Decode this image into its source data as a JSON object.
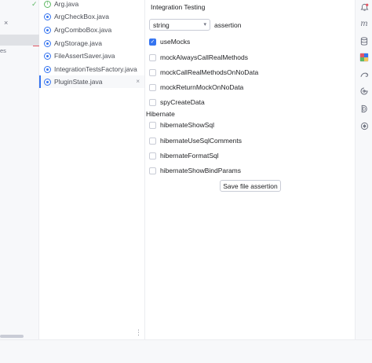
{
  "left_panel": {
    "close_glyph": "×",
    "truncated_text": "es"
  },
  "file_list": {
    "items": [
      {
        "name": "Arg.java",
        "icon": "interface-icon",
        "active": false
      },
      {
        "name": "ArgCheckBox.java",
        "icon": "class-icon",
        "active": false
      },
      {
        "name": "ArgComboBox.java",
        "icon": "class-icon",
        "active": false
      },
      {
        "name": "ArgStorage.java",
        "icon": "class-icon",
        "active": false
      },
      {
        "name": "FileAssertSaver.java",
        "icon": "class-icon",
        "active": false
      },
      {
        "name": "IntegrationTestsFactory.java",
        "icon": "class-icon",
        "active": false
      },
      {
        "name": "PluginState.java",
        "icon": "class-icon",
        "active": true
      }
    ],
    "close_glyph": "×",
    "check_glyph": "✓"
  },
  "panel": {
    "title": "Integration Testing",
    "combo": {
      "value": "string",
      "arrow": "▾"
    },
    "assertion_label": "assertion",
    "checkboxes": [
      {
        "label": "useMocks",
        "checked": true
      },
      {
        "label": "mockAlwaysCallRealMethods",
        "checked": false
      },
      {
        "label": "mockCallRealMethodsOnNoData",
        "checked": false
      },
      {
        "label": "mockReturnMockOnNoData",
        "checked": false
      },
      {
        "label": "spyCreateData",
        "checked": false
      }
    ],
    "section_title": "Hibernate",
    "hibernate_checkboxes": [
      {
        "label": "hibernateShowSql",
        "checked": false
      },
      {
        "label": "hibernateUseSqlComments",
        "checked": false
      },
      {
        "label": "hibernateFormatSql",
        "checked": false
      },
      {
        "label": "hibernateShowBindParams",
        "checked": false
      }
    ],
    "save_button": "Save file assertion"
  },
  "right_toolbar": {
    "icons": [
      "notifications-icon",
      "maven-icon",
      "database-icon",
      "integration-testing-icon",
      "gradle-icon",
      "ai-assistant-icon",
      "d-plugin-icon",
      "settings-plugin-icon"
    ]
  },
  "colors": {
    "accent": "#3574f0",
    "success": "#5fb865",
    "error": "#e55765"
  }
}
